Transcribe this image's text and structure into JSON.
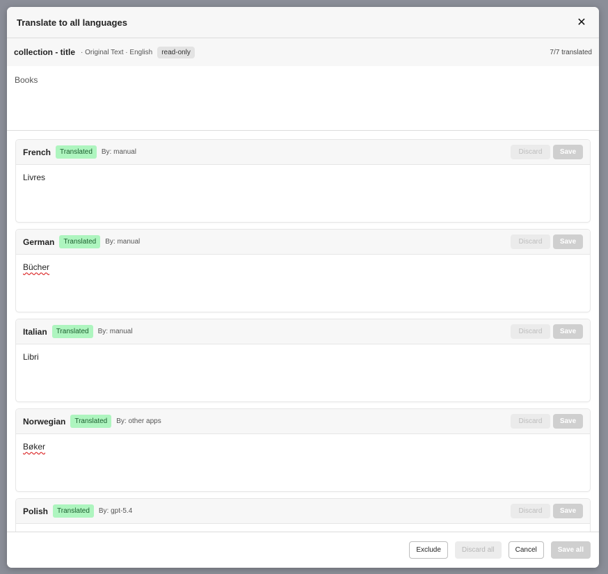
{
  "modal": {
    "title": "Translate to all languages",
    "close_icon": "close-icon"
  },
  "original": {
    "title": "collection - title",
    "meta": "· Original Text · English",
    "badge": "read-only",
    "count": "7/7 translated",
    "text": "Books"
  },
  "languages": [
    {
      "name": "French",
      "status": "Translated",
      "by": "By: manual",
      "text": "Livres",
      "discard": "Discard",
      "save": "Save"
    },
    {
      "name": "German",
      "status": "Translated",
      "by": "By: manual",
      "text": "Bücher",
      "discard": "Discard",
      "save": "Save"
    },
    {
      "name": "Italian",
      "status": "Translated",
      "by": "By: manual",
      "text": "Libri",
      "discard": "Discard",
      "save": "Save"
    },
    {
      "name": "Norwegian",
      "status": "Translated",
      "by": "By: other apps",
      "text": "Bøker",
      "discard": "Discard",
      "save": "Save"
    },
    {
      "name": "Polish",
      "status": "Translated",
      "by": "By: gpt-5.4",
      "text": "",
      "discard": "Discard",
      "save": "Save"
    }
  ],
  "footer": {
    "exclude": "Exclude",
    "discard_all": "Discard all",
    "cancel": "Cancel",
    "save_all": "Save all"
  }
}
